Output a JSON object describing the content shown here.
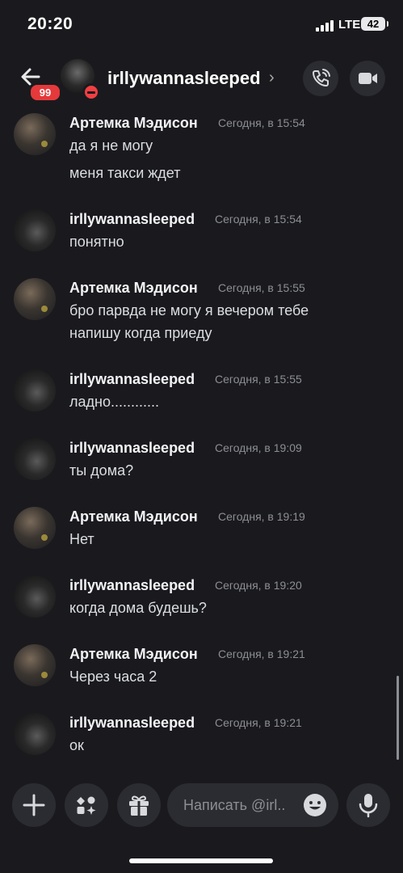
{
  "status_bar": {
    "time": "20:20",
    "network": "LTE",
    "battery": "42"
  },
  "header": {
    "unread_count": "99",
    "channel_name": "irllywannasleeped",
    "chevron": "›"
  },
  "messages": [
    {
      "author": "Артемка Мэдисон",
      "time": "Сегодня, в 15:54",
      "lines": [
        "да я не могу",
        "меня такси ждет"
      ]
    },
    {
      "author": "irllywannasleeped",
      "time": "Сегодня, в 15:54",
      "lines": [
        "понятно"
      ]
    },
    {
      "author": "Артемка Мэдисон",
      "time": "Сегодня, в 15:55",
      "lines": [
        "бро парвда не могу я вечером тебе",
        "напишу когда приеду"
      ]
    },
    {
      "author": "irllywannasleeped",
      "time": "Сегодня, в 15:55",
      "lines": [
        "ладно............"
      ]
    },
    {
      "author": "irllywannasleeped",
      "time": "Сегодня, в 19:09",
      "lines": [
        "ты дома?"
      ]
    },
    {
      "author": "Артемка Мэдисон",
      "time": "Сегодня, в 19:19",
      "lines": [
        "Нет"
      ]
    },
    {
      "author": "irllywannasleeped",
      "time": "Сегодня, в 19:20",
      "lines": [
        "когда дома будешь?"
      ]
    },
    {
      "author": "Артемка Мэдисон",
      "time": "Сегодня, в 19:21",
      "lines": [
        "Через часа 2"
      ]
    },
    {
      "author": "irllywannasleeped",
      "time": "Сегодня, в 19:21",
      "lines": [
        "ок"
      ]
    }
  ],
  "composer": {
    "placeholder": "Написать @irl.."
  },
  "icons": {
    "back": "arrow-left-icon",
    "call": "phone-icon",
    "video": "video-camera-icon",
    "add": "plus-icon",
    "apps": "apps-icon",
    "gift": "gift-icon",
    "emoji": "emoji-icon",
    "mic": "microphone-icon"
  }
}
